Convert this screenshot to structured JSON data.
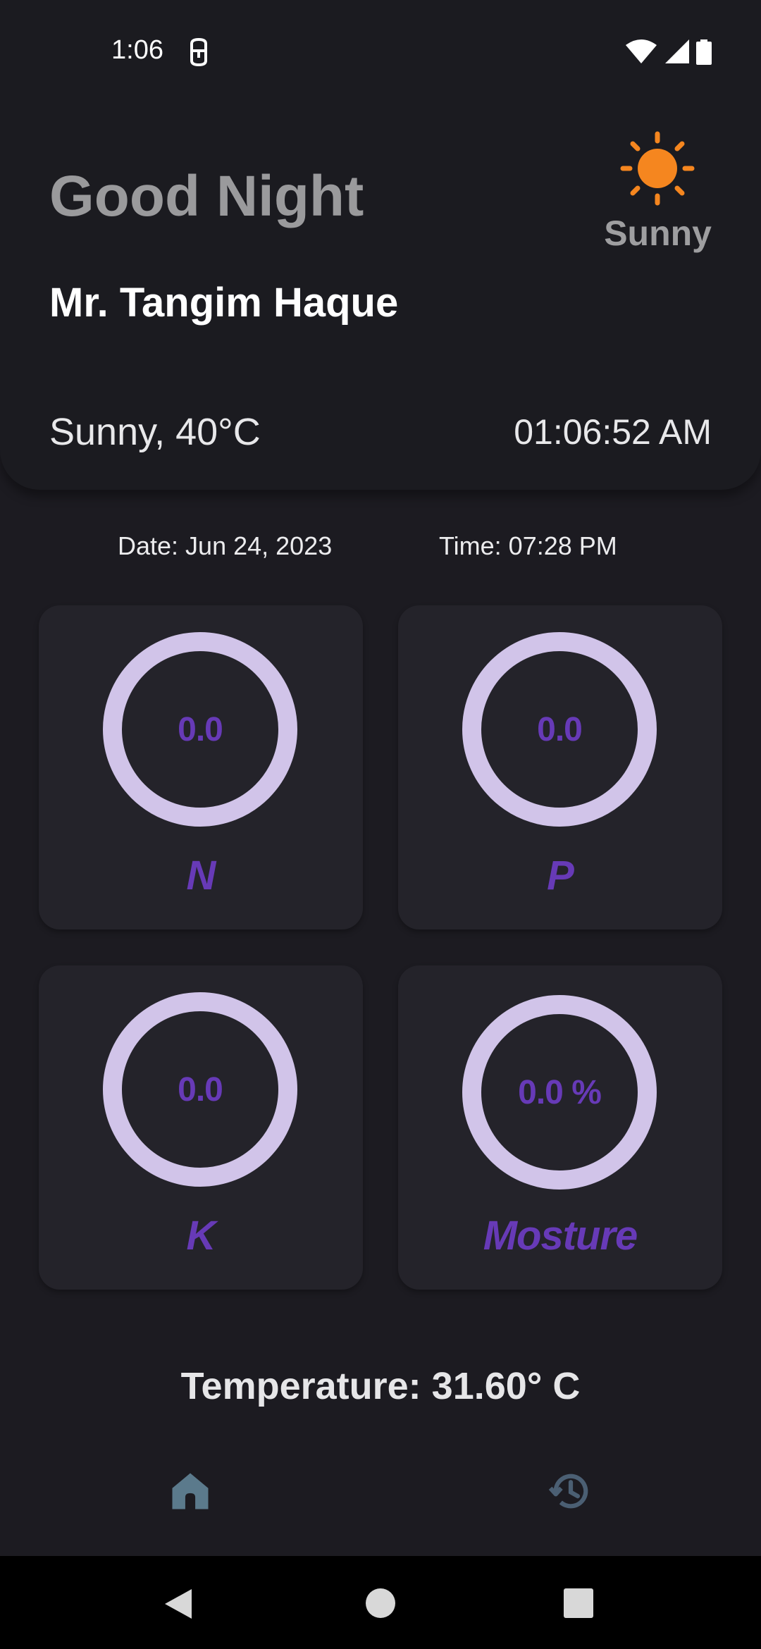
{
  "status_bar": {
    "time": "1:06",
    "icons": [
      "accessibility-icon",
      "wifi-icon",
      "signal-icon",
      "battery-icon"
    ]
  },
  "header": {
    "greeting": "Good Night",
    "user_name": "Mr. Tangim Haque",
    "weather_label": "Sunny",
    "weather_icon": "sun-icon",
    "weather_summary": "Sunny, 40°C",
    "clock": "01:06:52 AM"
  },
  "reading_info": {
    "date": "Date: Jun 24, 2023",
    "time": "Time: 07:28 PM"
  },
  "sensors": [
    {
      "label": "N",
      "value": "0.0"
    },
    {
      "label": "P",
      "value": "0.0"
    },
    {
      "label": "K",
      "value": "0.0"
    },
    {
      "label": "Mosture",
      "value": "0.0 %"
    }
  ],
  "temperature": "Temperature: 31.60° C",
  "bottom_nav": {
    "items": [
      {
        "icon": "home-icon",
        "active": true
      },
      {
        "icon": "history-icon",
        "active": false
      }
    ]
  },
  "colors": {
    "background": "#1c1b21",
    "card": "#24232a",
    "ring": "#d1c4e9",
    "accent": "#673ab7",
    "sun": "#f5861f",
    "nav_active": "#5b7a8c"
  }
}
